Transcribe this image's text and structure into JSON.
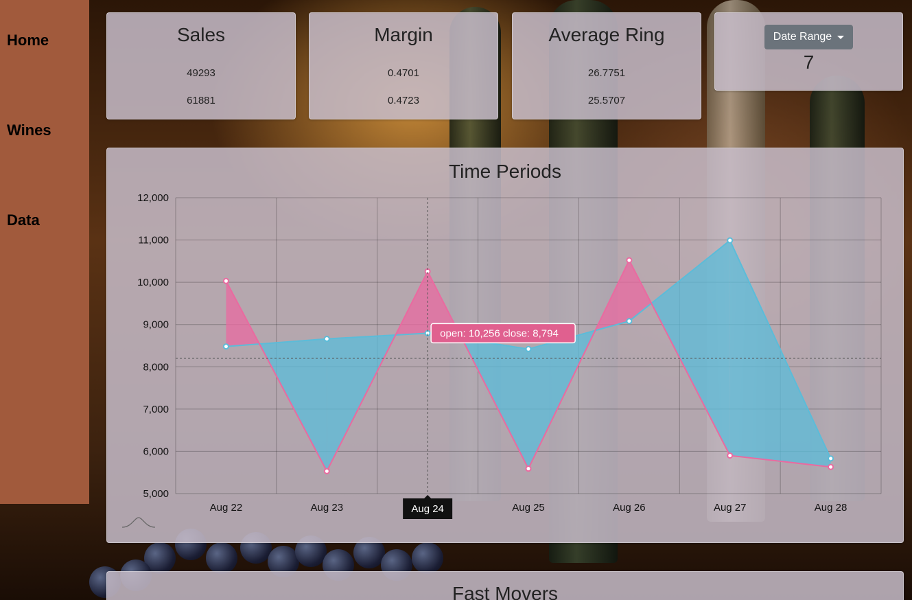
{
  "sidebar": {
    "items": [
      {
        "label": "Home"
      },
      {
        "label": "Wines"
      },
      {
        "label": "Data"
      }
    ]
  },
  "kpis": [
    {
      "title": "Sales",
      "current": "49293",
      "previous": "61881"
    },
    {
      "title": "Margin",
      "current": "0.4701",
      "previous": "0.4723"
    },
    {
      "title": "Average Ring",
      "current": "26.7751",
      "previous": "25.5707"
    }
  ],
  "date_range": {
    "button_label": "Date Range",
    "value": "7"
  },
  "time_periods": {
    "title": "Time Periods",
    "tooltip": "open: 10,256 close: 8,794",
    "crosshair_label": "Aug 24",
    "colors": {
      "open": "#ea6aa0",
      "close": "#5bbcd9",
      "tooltip_bg": "#e0608f"
    }
  },
  "fast_movers": {
    "title": "Fast Movers"
  },
  "chart_data": {
    "type": "area",
    "title": "Time Periods",
    "categories": [
      "Aug 22",
      "Aug 23",
      "Aug 24",
      "Aug 25",
      "Aug 26",
      "Aug 27",
      "Aug 28"
    ],
    "series": [
      {
        "name": "open",
        "values": [
          10030,
          5530,
          10256,
          5590,
          10520,
          5900,
          5630
        ]
      },
      {
        "name": "close",
        "values": [
          8480,
          8660,
          8794,
          8420,
          9080,
          10990,
          5830
        ]
      }
    ],
    "ylim": [
      5000,
      12000
    ],
    "yticks": [
      "5,000",
      "6,000",
      "7,000",
      "8,000",
      "9,000",
      "10,000",
      "11,000",
      "12,000"
    ],
    "grid": true
  }
}
